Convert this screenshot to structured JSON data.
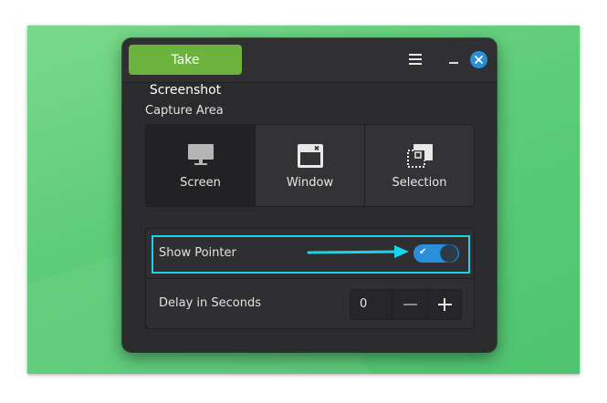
{
  "titlebar": {
    "take_screenshot_label": "Take Screenshot",
    "menu_icon": "hamburger-menu-icon",
    "minimize_icon": "minimize-icon",
    "close_icon": "close-icon"
  },
  "capture_area": {
    "label": "Capture Area",
    "options": [
      {
        "label": "Screen",
        "icon": "monitor-icon",
        "selected": true
      },
      {
        "label": "Window",
        "icon": "window-icon",
        "selected": false
      },
      {
        "label": "Selection",
        "icon": "selection-icon",
        "selected": false
      }
    ]
  },
  "options": {
    "show_pointer_label": "Show Pointer",
    "show_pointer_enabled": true,
    "delay_label": "Delay in Seconds",
    "delay_value": "0"
  },
  "colors": {
    "accent_blue": "#2a8fdb",
    "button_green": "#6bb33c",
    "highlight_cyan": "#19d3e8",
    "window_bg": "#2b2b2e"
  }
}
